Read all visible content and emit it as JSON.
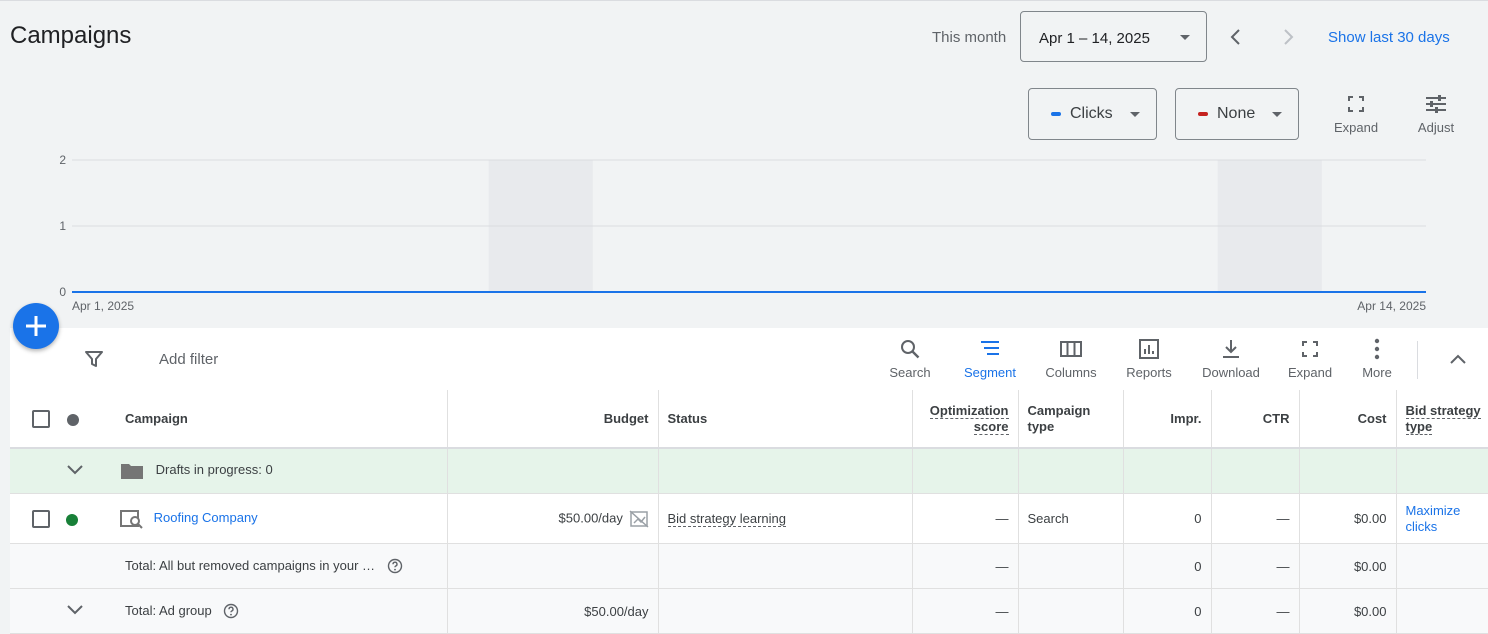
{
  "header": {
    "title": "Campaigns",
    "period_label": "This month",
    "date_range": "Apr 1 – 14, 2025",
    "show_last_link": "Show last 30 days"
  },
  "metric_selectors": [
    {
      "label": "Clicks",
      "color": "#1a73e8"
    },
    {
      "label": "None",
      "color": "#c5221f"
    }
  ],
  "chart_tools": {
    "expand": "Expand",
    "adjust": "Adjust"
  },
  "chart_data": {
    "type": "line",
    "x": [
      "Apr 1, 2025",
      "Apr 14, 2025"
    ],
    "series": [
      {
        "values": [
          0,
          0
        ]
      }
    ],
    "yticks": [
      0,
      1,
      2
    ],
    "ylim": [
      0,
      2
    ],
    "grid": true,
    "shaded_ranges": [
      [
        5,
        6
      ],
      [
        12,
        13
      ]
    ]
  },
  "toolbar": {
    "add_filter": "Add filter",
    "items": [
      "Search",
      "Segment",
      "Columns",
      "Reports",
      "Download",
      "Expand",
      "More"
    ]
  },
  "table": {
    "headers": {
      "campaign": "Campaign",
      "budget": "Budget",
      "status": "Status",
      "optimization_1": "Optimization",
      "optimization_2": "score",
      "campaign_type_1": "Campaign",
      "campaign_type_2": "type",
      "impr": "Impr.",
      "ctr": "CTR",
      "cost": "Cost",
      "bid_1": "Bid strategy",
      "bid_2": "type"
    },
    "drafts_label": "Drafts in progress: 0",
    "campaign_row": {
      "name": "Roofing Company",
      "budget": "$50.00/day",
      "status": "Bid strategy learning",
      "opt_score": "—",
      "type": "Search",
      "impr": "0",
      "ctr": "—",
      "cost": "$0.00",
      "bid_1": "Maximize",
      "bid_2": "clicks"
    },
    "total_all": {
      "label": "Total: All but removed campaigns in your …",
      "opt_score": "—",
      "impr": "0",
      "ctr": "—",
      "cost": "$0.00"
    },
    "total_adgroup": {
      "label": "Total: Ad group",
      "budget": "$50.00/day",
      "opt_score": "—",
      "impr": "0",
      "ctr": "—",
      "cost": "$0.00"
    }
  }
}
